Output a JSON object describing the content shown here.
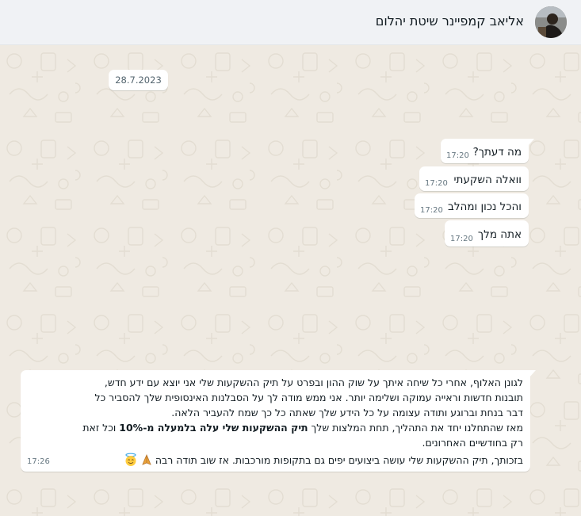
{
  "header": {
    "contact_name": "אליאב קמפיינר שיטת יהלום",
    "avatar": "contact-photo"
  },
  "chat": {
    "date_label": "28.7.2023",
    "messages": [
      {
        "text": "מה דעתך?",
        "time": "17:20"
      },
      {
        "text": "וואלה השקעתי",
        "time": "17:20"
      },
      {
        "text": "והכל נכון ומהלב",
        "time": "17:20"
      },
      {
        "text": "אתה מלך",
        "time": "17:20"
      }
    ],
    "long_message": {
      "line1": "לגונן האלוף, אחרי כל שיחה איתך על שוק ההון ובפרט על תיק ההשקעות שלי אני יוצא עם ידע חדש,",
      "line2": "תובנות חדשות וראייה עמוקה ושלימה יותר. אני ממש מודה לך על הסבלנות האינסופית שלך להסביר כל",
      "line3": "דבר בנחת וברוגע ותודה עצומה על כל הידע שלך שאתה כל כך שמח להעביר הלאה.",
      "line4_pre": "מאז שהתחלנו יחד את התהליך, תחת המלצות שלך ",
      "line4_bold": "תיק ההשקעות שלי עלה בלמעלה מ-10%",
      "line4_post": " וכל זאת",
      "line5": "רק בחודשיים האחרונים.",
      "line6": "בזכותך, תיק ההשקעות שלי עושה ביצועים יפים גם בתקופות מורכבות. אז שוב תודה רבה",
      "emojis": [
        "folded-hands-emoji",
        "smiling-face-with-halo-emoji"
      ],
      "time": "17:26"
    }
  }
}
